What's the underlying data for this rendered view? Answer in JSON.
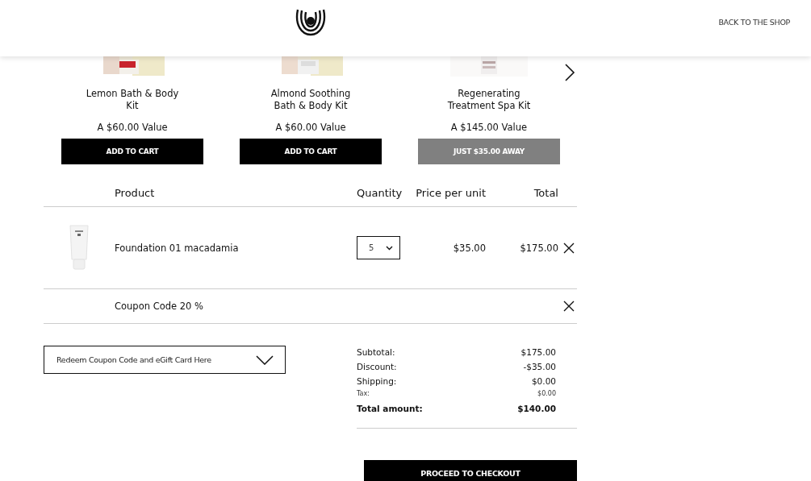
{
  "header": {
    "link": "BACK TO THE SHOP"
  },
  "offers": [
    {
      "name": "Lemon Bath & Body\nKit",
      "value": "A $60.00 Value",
      "button": "ADD TO CART",
      "kind": "add"
    },
    {
      "name": "Almond Soothing\nBath & Body Kit",
      "value": "A $60.00 Value",
      "button": "ADD TO CART",
      "kind": "add"
    },
    {
      "name": "Regenerating\nTreatment Spa Kit",
      "value": "A $145.00 Value",
      "button": "JUST $35.00 AWAY",
      "kind": "away"
    }
  ],
  "table": {
    "columns": [
      "Product",
      "Quantity",
      "Price per unit",
      "Total"
    ],
    "rows": [
      {
        "kind": "product",
        "name": "Foundation 01 macadamia",
        "quantity": "5",
        "price": "$35.00",
        "total": "$175.00"
      },
      {
        "kind": "coupon",
        "name": "Coupon Code 20 %"
      }
    ]
  },
  "coupon_dropdown": {
    "label": "Redeem Coupon Code and eGift Card Here"
  },
  "summary": [
    {
      "label": "Subtotal:",
      "value": "$175.00",
      "kind": "normal"
    },
    {
      "label": "Discount:",
      "value": "-$35.00",
      "kind": "normal"
    },
    {
      "label": "Shipping:",
      "value": "$0.00",
      "kind": "normal"
    },
    {
      "label": "Tax:",
      "value": "$0.00",
      "kind": "small"
    },
    {
      "label": "Total amount:",
      "value": "$140.00",
      "kind": "total"
    }
  ],
  "checkout_button": "PROCEED TO CHECKOUT"
}
